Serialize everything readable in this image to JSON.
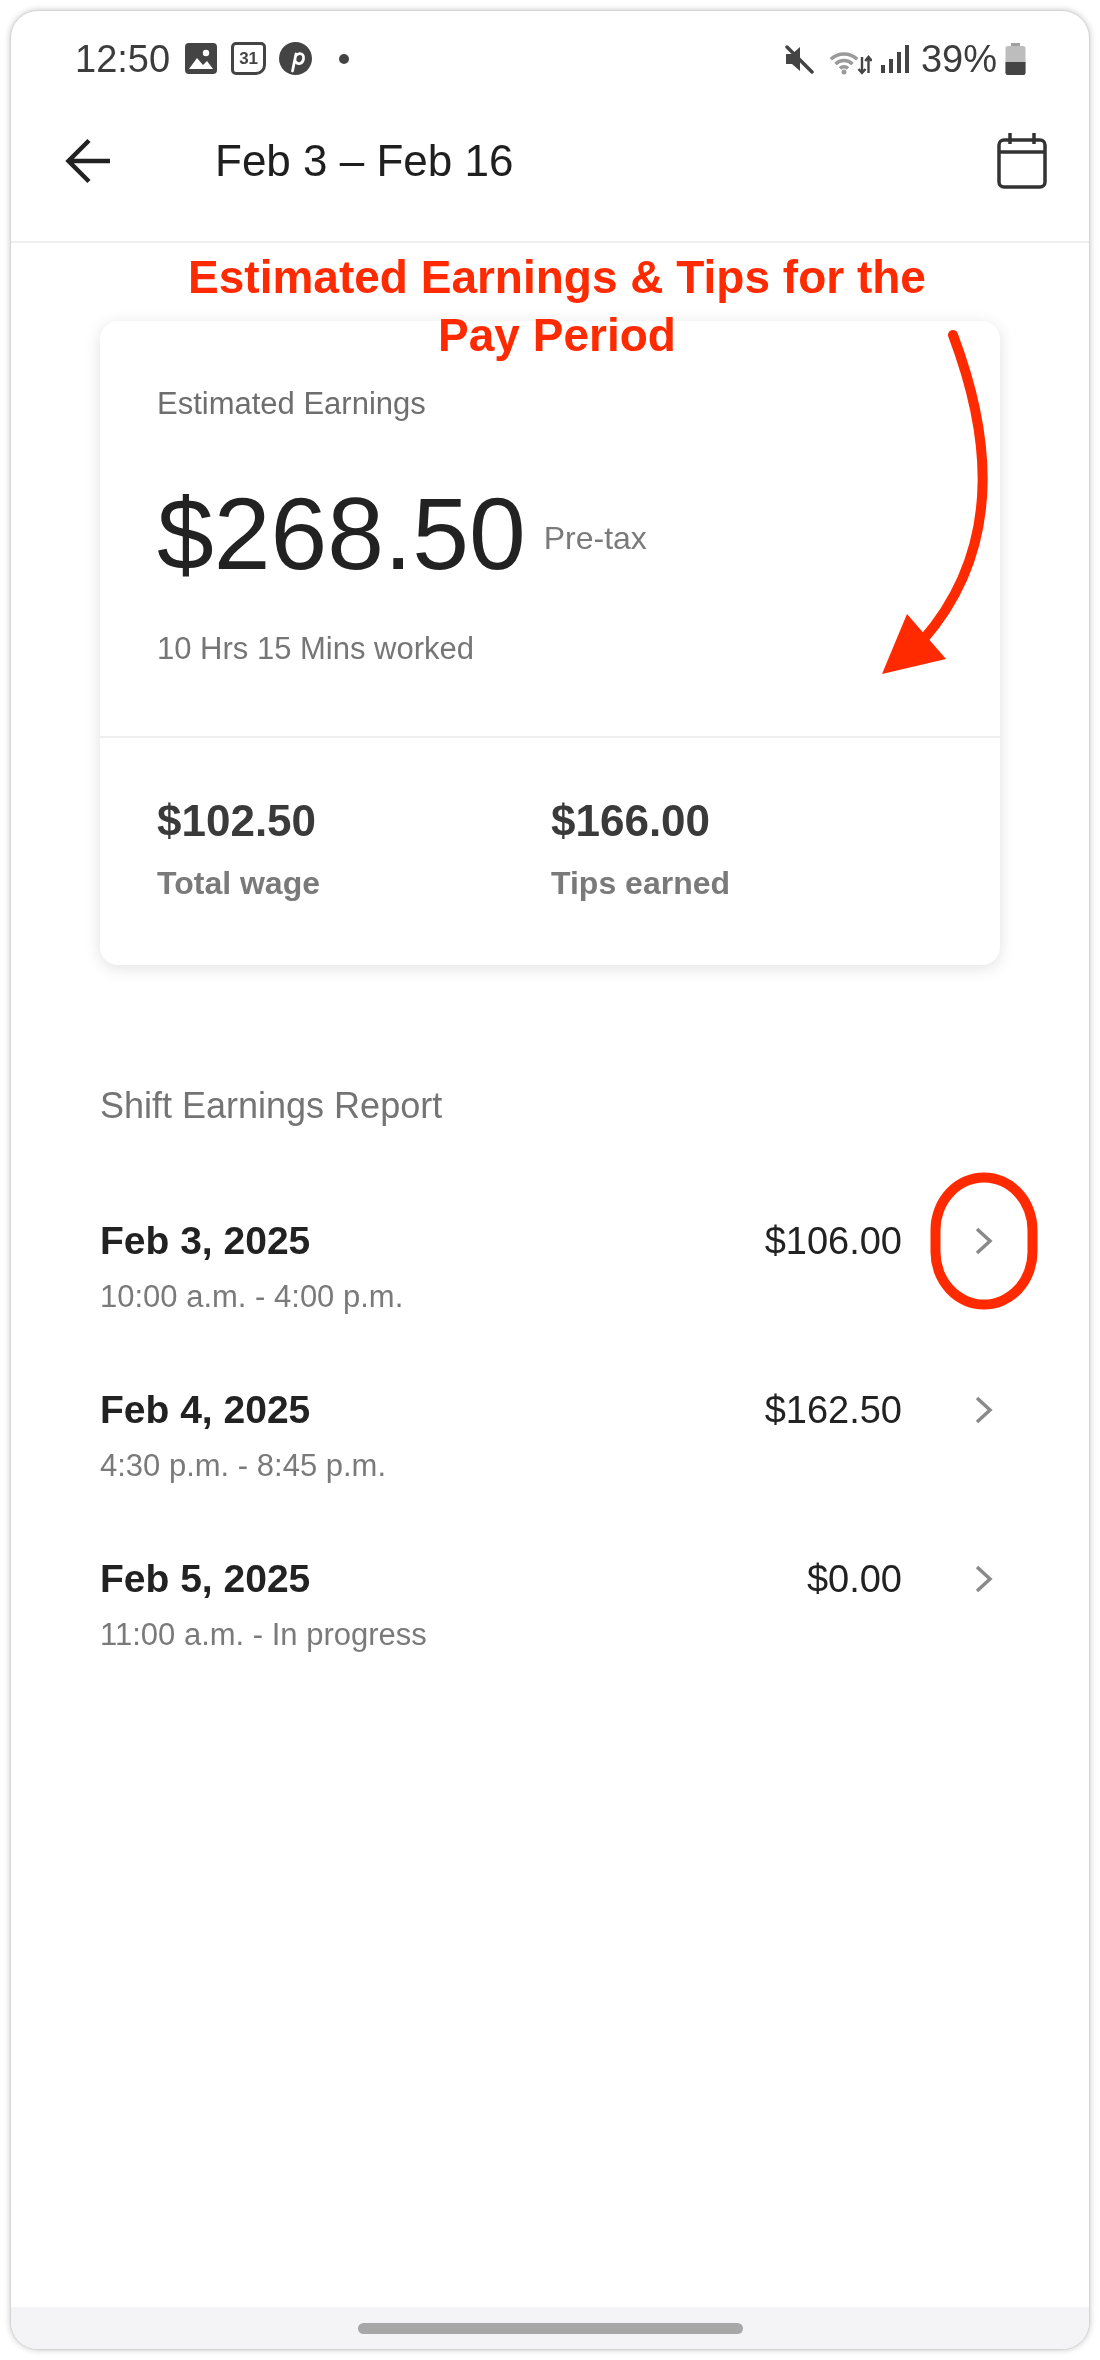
{
  "status_bar": {
    "time": "12:50",
    "calendar_date": "31",
    "battery": "39%"
  },
  "header": {
    "title": "Feb 3 – Feb 16"
  },
  "annotation": {
    "text": "Estimated Earnings & Tips for the Pay Period"
  },
  "earnings_card": {
    "label": "Estimated Earnings",
    "amount": "$268.50",
    "amount_note": "Pre-tax",
    "hours": "10 Hrs 15 Mins worked",
    "breakdown": [
      {
        "value": "$102.50",
        "label": "Total wage"
      },
      {
        "value": "$166.00",
        "label": "Tips earned"
      }
    ]
  },
  "shift_report": {
    "title": "Shift Earnings Report",
    "shifts": [
      {
        "date": "Feb 3, 2025",
        "time": "10:00 a.m. - 4:00 p.m.",
        "amount": "$106.00",
        "circled": true
      },
      {
        "date": "Feb 4, 2025",
        "time": "4:30 p.m. - 8:45 p.m.",
        "amount": "$162.50",
        "circled": false
      },
      {
        "date": "Feb 5, 2025",
        "time": "11:00 a.m. - In progress",
        "amount": "$0.00",
        "circled": false
      }
    ]
  }
}
